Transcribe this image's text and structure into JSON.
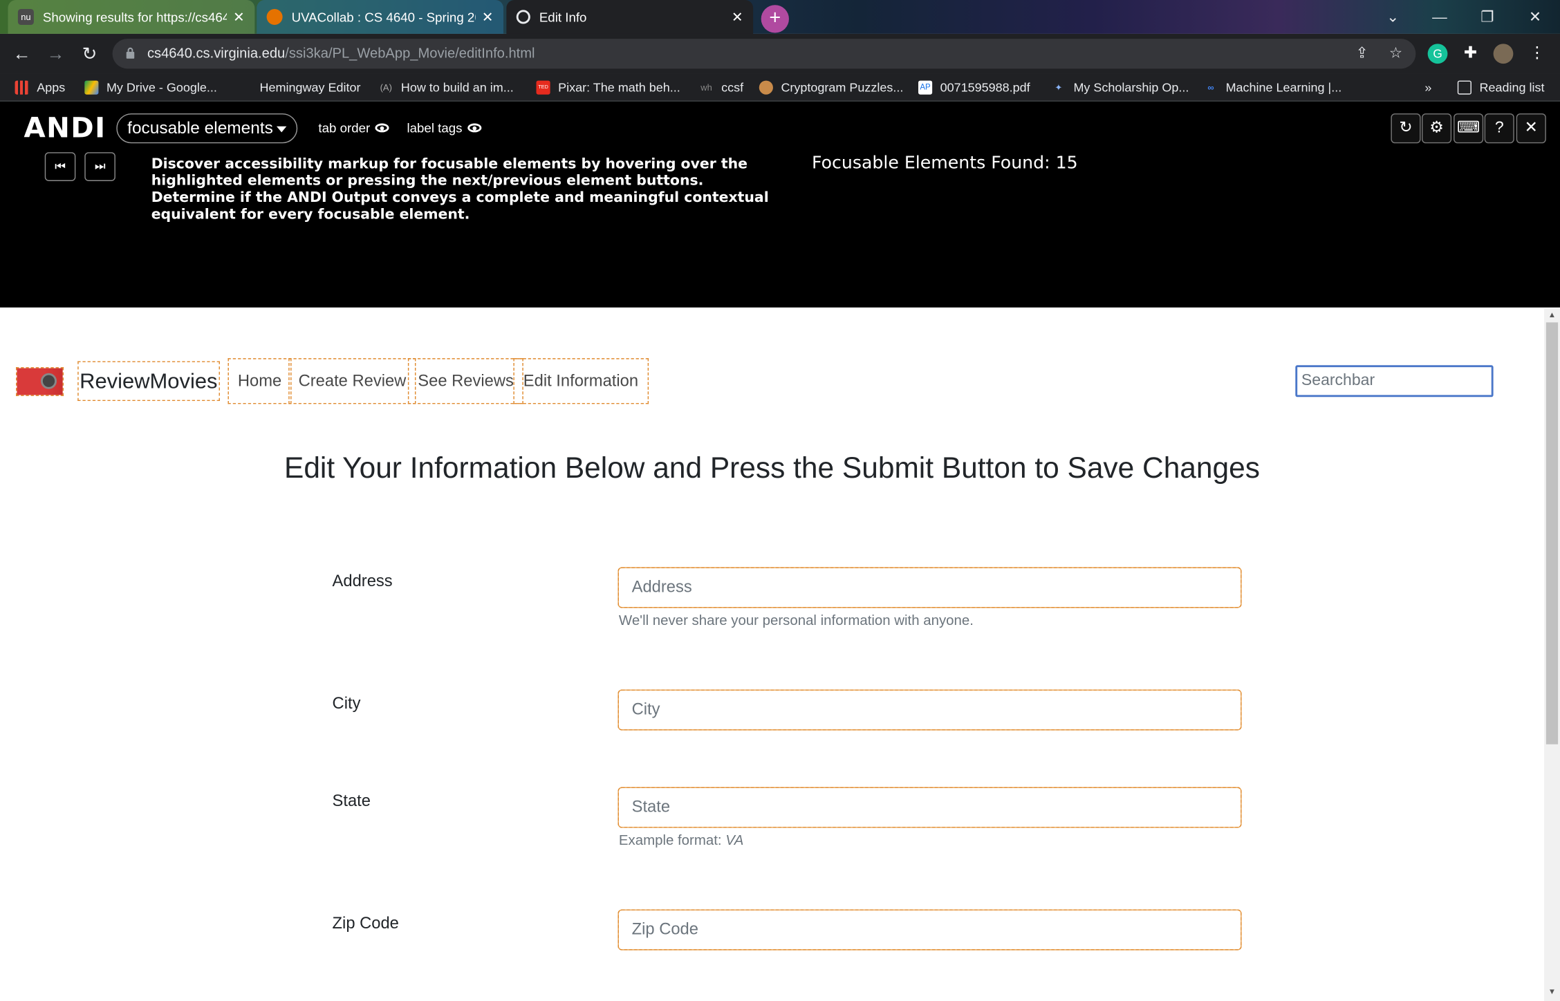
{
  "browser": {
    "tabs": [
      {
        "title": "Showing results for https://cs464",
        "close": "✕"
      },
      {
        "title": "UVACollab : CS 4640 - Spring 202",
        "close": "✕"
      },
      {
        "title": "Edit Info",
        "close": "✕"
      }
    ],
    "new_tab": "+",
    "url_host": "cs4640.cs.virginia.edu",
    "url_path": "/ssi3ka/PL_WebApp_Movie/editInfo.html",
    "bookmarks": [
      {
        "label": "Apps"
      },
      {
        "label": "My Drive - Google..."
      },
      {
        "label": "Hemingway Editor"
      },
      {
        "label": "How to build an im..."
      },
      {
        "label": "Pixar: The math beh..."
      },
      {
        "label": "ccsf"
      },
      {
        "label": "Cryptogram Puzzles..."
      },
      {
        "label": "0071595988.pdf"
      },
      {
        "label": "My Scholarship Op..."
      },
      {
        "label": "Machine Learning |..."
      }
    ],
    "bookmarks_overflow": "»",
    "reading_list": "Reading list"
  },
  "andi": {
    "logo": "ANDI",
    "module": "focusable elements",
    "toggle_tab_order": "tab order",
    "toggle_label_tags": "label tags",
    "description": "Discover accessibility markup for focusable elements by hovering over the highlighted elements or pressing the next/previous element buttons. Determine if the ANDI Output conveys a complete and meaningful contextual equivalent for every focusable element.",
    "count_text": "Focusable Elements Found: 15",
    "buttons": {
      "refresh": "↻",
      "settings": "⚙",
      "keyboard": "⌨",
      "help": "?",
      "close": "✕"
    },
    "prev": "⏮",
    "next": "⏭"
  },
  "site": {
    "brand": "ReviewMovies",
    "nav": [
      {
        "label": "Home"
      },
      {
        "label": "Create Review"
      },
      {
        "label": "See Reviews"
      },
      {
        "label": "Edit Information"
      }
    ],
    "search_placeholder": "Searchbar",
    "heading": "Edit Your Information Below and Press the Submit Button to Save Changes",
    "fields": [
      {
        "label": "Address",
        "placeholder": "Address",
        "help": "We'll never share your personal information with anyone."
      },
      {
        "label": "City",
        "placeholder": "City"
      },
      {
        "label": "State",
        "placeholder": "State",
        "help_prefix": "Example format: ",
        "help_example": "VA"
      },
      {
        "label": "Zip Code",
        "placeholder": "Zip Code"
      }
    ]
  }
}
